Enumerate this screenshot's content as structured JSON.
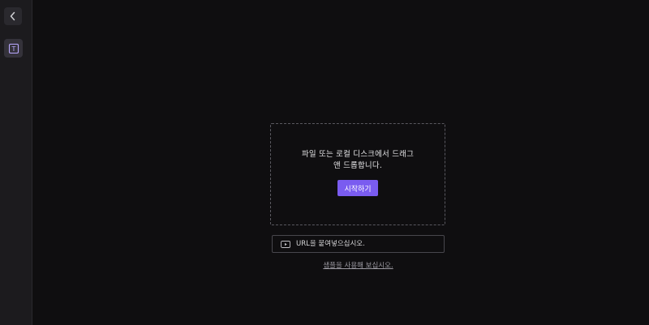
{
  "rail": {
    "back_icon": "chevron-left-icon",
    "text_tool_icon": "text-box-icon",
    "text_tool_glyph": "T"
  },
  "dropzone": {
    "message": "파일 또는 로컬 디스크에서 드래그 앤 드롭합니다.",
    "start_button_label": "시작하기"
  },
  "url_input": {
    "icon": "video-play-icon",
    "placeholder": "URL을 붙여넣으십시오."
  },
  "sample_link": {
    "label": "샘플을 사용해 보십시오."
  },
  "colors": {
    "background": "#0f0e10",
    "rail": "#1c1b1e",
    "accent": "#7a5cf0"
  }
}
